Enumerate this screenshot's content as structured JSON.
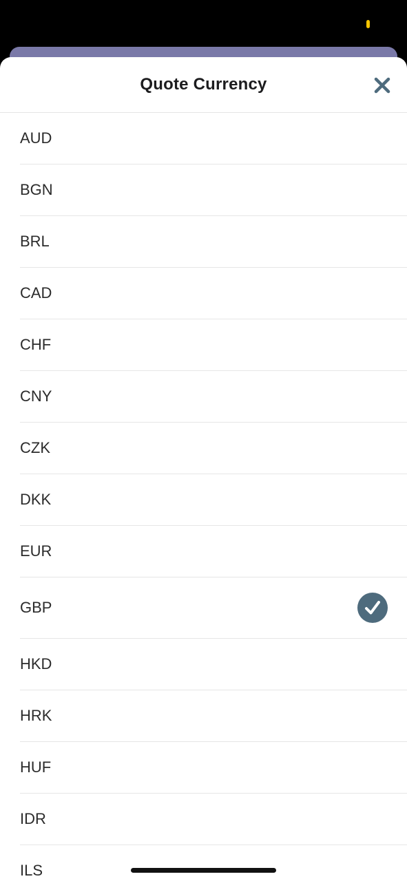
{
  "sheet": {
    "title": "Quote Currency",
    "close_icon": "close-x-icon"
  },
  "currencies": [
    {
      "code": "AUD",
      "selected": false
    },
    {
      "code": "BGN",
      "selected": false
    },
    {
      "code": "BRL",
      "selected": false
    },
    {
      "code": "CAD",
      "selected": false
    },
    {
      "code": "CHF",
      "selected": false
    },
    {
      "code": "CNY",
      "selected": false
    },
    {
      "code": "CZK",
      "selected": false
    },
    {
      "code": "DKK",
      "selected": false
    },
    {
      "code": "EUR",
      "selected": false
    },
    {
      "code": "GBP",
      "selected": true
    },
    {
      "code": "HKD",
      "selected": false
    },
    {
      "code": "HRK",
      "selected": false
    },
    {
      "code": "HUF",
      "selected": false
    },
    {
      "code": "IDR",
      "selected": false
    },
    {
      "code": "ILS",
      "selected": false
    }
  ],
  "colors": {
    "accent_check": "#4e6b7d",
    "background_card": "#7a79a8",
    "close_icon": "#4e6b7d"
  }
}
